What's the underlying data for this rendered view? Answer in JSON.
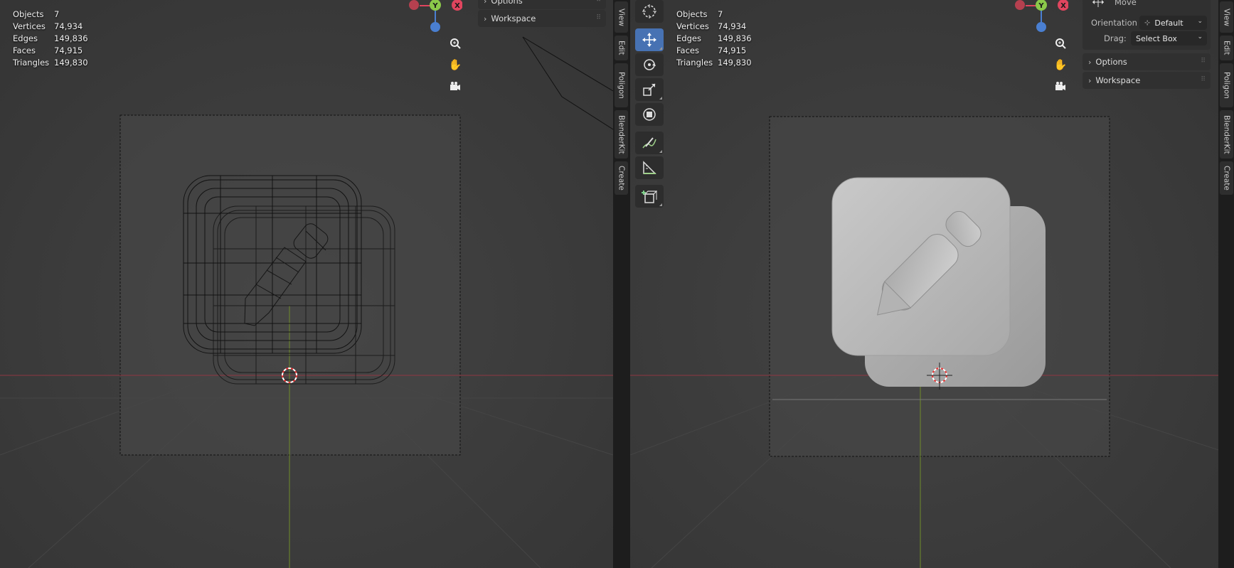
{
  "stats_left": [
    {
      "label": "Objects",
      "value": "7"
    },
    {
      "label": "Vertices",
      "value": "74,934"
    },
    {
      "label": "Edges",
      "value": "149,836"
    },
    {
      "label": "Faces",
      "value": "74,915"
    },
    {
      "label": "Triangles",
      "value": "149,830"
    }
  ],
  "stats_right": [
    {
      "label": "Objects",
      "value": "7"
    },
    {
      "label": "Vertices",
      "value": "74,934"
    },
    {
      "label": "Edges",
      "value": "149,836"
    },
    {
      "label": "Faces",
      "value": "74,915"
    },
    {
      "label": "Triangles",
      "value": "149,830"
    }
  ],
  "axis_gizmo": {
    "y_label": "Y",
    "x_label": "X",
    "x_color": "#e0455e",
    "y_color": "#8bc94a",
    "z_color": "#4a7fd1"
  },
  "nav_icons": [
    "zoom-icon",
    "hand-pan-icon",
    "camera-icon"
  ],
  "left_panel": {
    "options_label": "Options",
    "workspace_label": "Workspace"
  },
  "left_tabs": [
    "View",
    "Edit",
    "Poligon",
    "BlenderKit",
    "Create"
  ],
  "right_tabs": [
    "View",
    "Edit",
    "Poligon",
    "BlenderKit",
    "Create"
  ],
  "tools": [
    "cursor-icon",
    "move-icon",
    "rotate-icon",
    "scale-icon",
    "transform-icon",
    "annotate-icon",
    "measure-icon",
    "add-cube-icon"
  ],
  "active_tool": "move-icon",
  "tool_settings": {
    "move_label": "Move",
    "orientation_label": "Orientation",
    "orientation_value": "Default",
    "drag_label": "Drag:",
    "drag_value": "Select Box",
    "options_label": "Options",
    "workspace_label": "Workspace"
  },
  "colors": {
    "accent": "#4772b3",
    "x_axis": "#a23a48",
    "y_axis": "#7a9a2e"
  }
}
